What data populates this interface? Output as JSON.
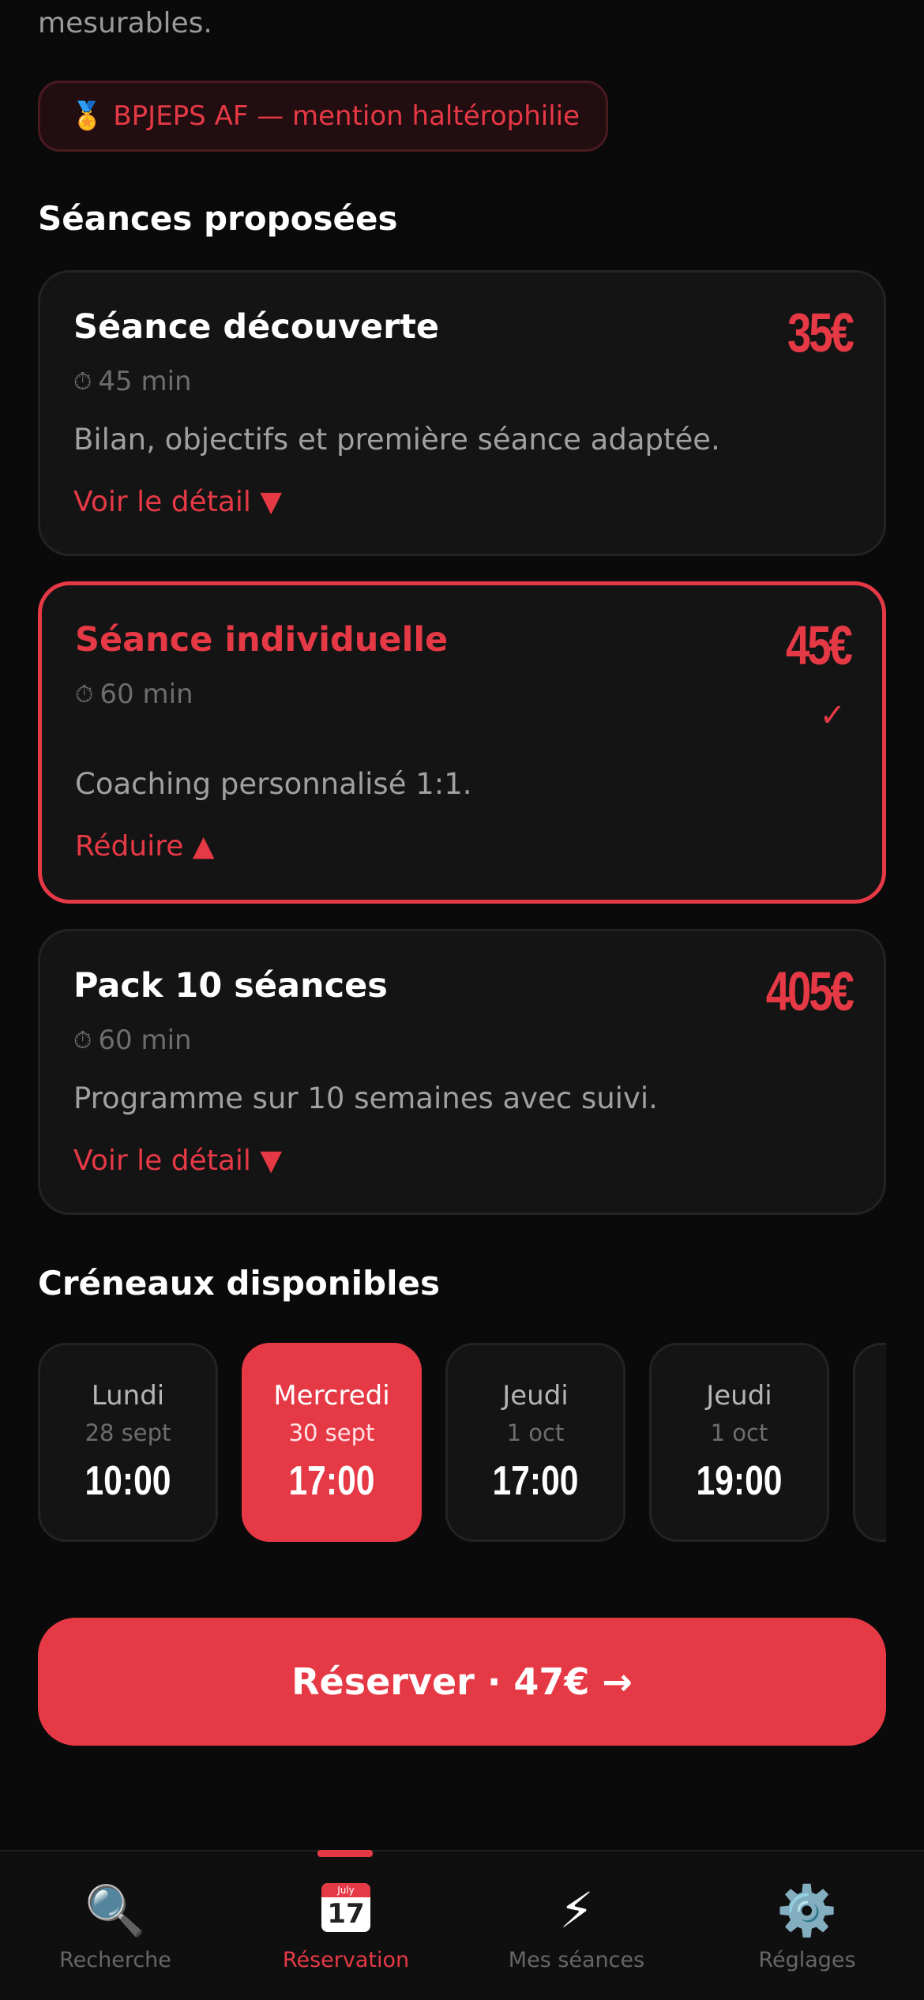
{
  "intro": {
    "text": "mesurables."
  },
  "certification": {
    "medal": "🏅",
    "label": "BPJEPS AF — mention haltérophilie"
  },
  "sessions_section": {
    "title": "Séances proposées"
  },
  "offers": [
    {
      "name": "Séance découverte",
      "duration": "45 min",
      "description": "Bilan, objectifs et première séance adaptée.",
      "toggle": "Voir le détail ▼",
      "price": "35€"
    },
    {
      "name": "Séance individuelle",
      "duration": "60 min",
      "description": "Coaching personnalisé 1:1.",
      "toggle": "Réduire ▲",
      "price": "45€",
      "check": "✓"
    },
    {
      "name": "Pack 10 séances",
      "duration": "60 min",
      "description": "Programme sur 10 semaines avec suivi.",
      "toggle": "Voir le détail ▼",
      "price": "405€"
    }
  ],
  "clock_icon": "⏱",
  "slots_section": {
    "title": "Créneaux disponibles"
  },
  "slots": [
    {
      "day": "Lundi",
      "date": "28 sept",
      "time": "10:00"
    },
    {
      "day": "Mercredi",
      "date": "30 sept",
      "time": "17:00"
    },
    {
      "day": "Jeudi",
      "date": "1 oct",
      "time": "17:00"
    },
    {
      "day": "Jeudi",
      "date": "1 oct",
      "time": "19:00"
    }
  ],
  "book_button": {
    "label": "Réserver · 47€ →"
  },
  "tabs": [
    {
      "label": "Recherche",
      "icon": "🔍"
    },
    {
      "label": "Réservation",
      "icon_month": "July",
      "icon_day": "17"
    },
    {
      "label": "Mes séances",
      "icon": "⚡"
    },
    {
      "label": "Réglages",
      "icon": "⚙️"
    }
  ],
  "colors": {
    "accent": "#e63946",
    "background": "#0a0a0a",
    "card": "#141414"
  }
}
